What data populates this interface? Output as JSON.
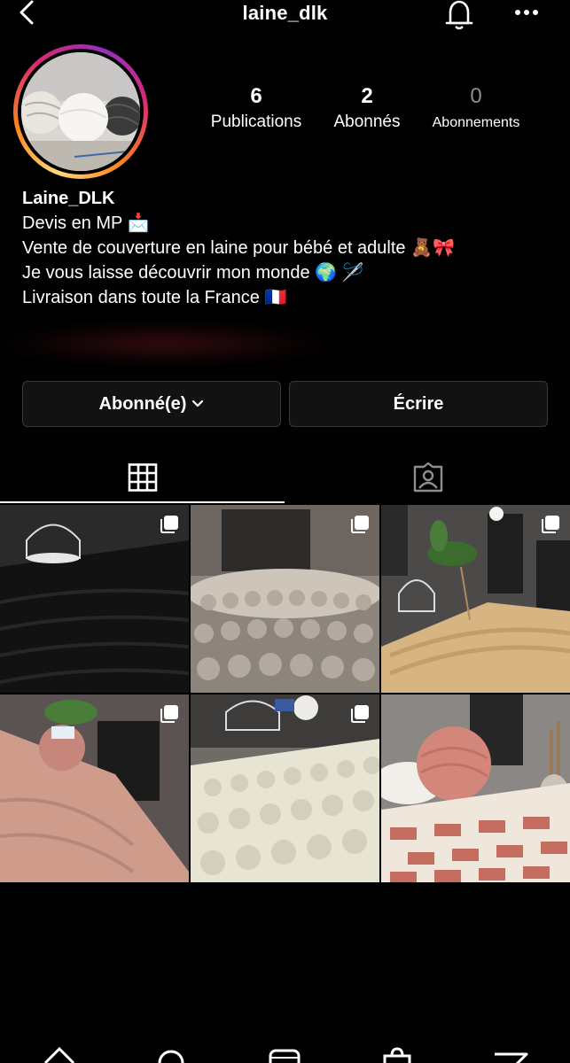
{
  "header": {
    "username": "laine_dlk",
    "back_icon": "chevron-left-icon",
    "bell_icon": "bell-icon",
    "more_icon": "more-horizontal-icon"
  },
  "profile": {
    "stats": [
      {
        "value": "6",
        "label": "Publications"
      },
      {
        "value": "2",
        "label": "Abonnés"
      },
      {
        "value": "0",
        "label": "Abonnements"
      }
    ],
    "name": "Laine_DLK",
    "bio_lines": [
      "Devis en MP 📩",
      "Vente de couverture en laine pour bébé et adulte 🧸🎀",
      "Je vous laisse découvrir mon monde 🌍 🪡",
      "Livraison dans toute la France 🇫🇷"
    ]
  },
  "actions": {
    "follow_label": "Abonné(e)",
    "write_label": "Écrire"
  },
  "tabs": [
    {
      "icon": "grid-icon",
      "active": true
    },
    {
      "icon": "tagged-person-icon",
      "active": false
    }
  ],
  "posts": [
    {
      "id": "post-1",
      "desc": "black knitted blanket with birdcage",
      "multi": true
    },
    {
      "id": "post-2",
      "desc": "taupe bobble blanket",
      "multi": true
    },
    {
      "id": "post-3",
      "desc": "beige blanket with orchid",
      "multi": true
    },
    {
      "id": "post-4",
      "desc": "pink blanket with yarn ball",
      "multi": true
    },
    {
      "id": "post-5",
      "desc": "cream bobble blanket",
      "multi": true
    },
    {
      "id": "post-6",
      "desc": "pink and white blanket with yarn",
      "multi": false
    }
  ],
  "bottom_nav": [
    "home-icon",
    "search-icon",
    "reels-icon",
    "shop-icon",
    "messages-icon"
  ],
  "colors": {
    "background": "#000000",
    "button_bg": "#121212",
    "button_border": "#3a3a3a",
    "muted": "#8e8e8e"
  }
}
